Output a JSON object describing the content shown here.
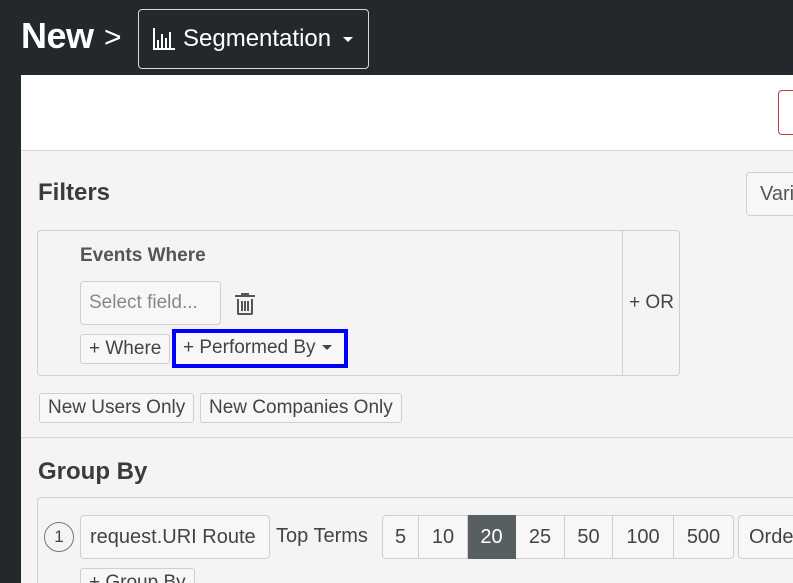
{
  "header": {
    "title": "New",
    "separator": ">",
    "segment_selector": {
      "label": "Segmentation",
      "icon": "bar-chart-icon"
    }
  },
  "filters": {
    "heading": "Filters",
    "variation_button": "Vari",
    "events_where": "Events Where",
    "select_field_placeholder": "Select field...",
    "add_where": "+ Where",
    "performed_by": "+ Performed By",
    "or_button": "+ OR",
    "new_users_only": "New Users Only",
    "new_companies_only": "New Companies Only"
  },
  "group_by": {
    "heading": "Group By",
    "index": "1",
    "field": "request.URI Route",
    "top_terms_label": "Top Terms",
    "term_options": [
      "5",
      "10",
      "20",
      "25",
      "50",
      "100",
      "500"
    ],
    "selected_term": "20",
    "order_button": "Orde",
    "add_group_by": "+ Group By"
  },
  "colors": {
    "background_dark": "#23282d",
    "panel": "#f4f4f4",
    "highlight_border": "#0000ff",
    "active_term": "#575f63",
    "accent_red": "#c43a3a"
  }
}
